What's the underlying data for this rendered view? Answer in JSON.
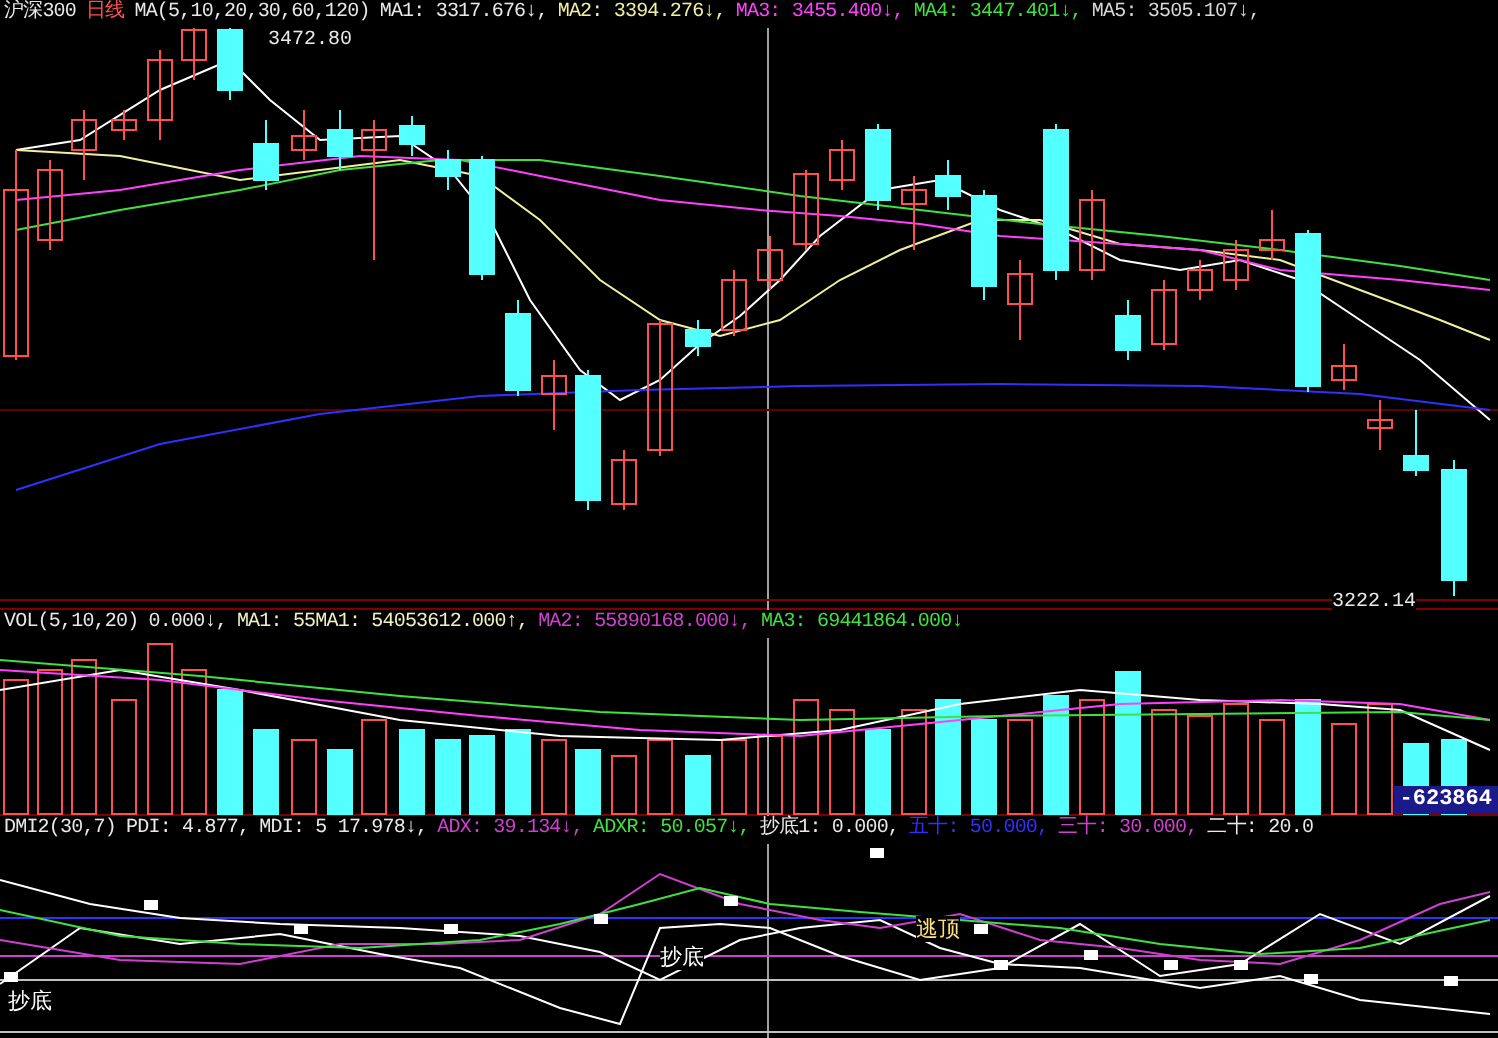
{
  "price_panel": {
    "header": [
      {
        "text": "沪深300",
        "color": "#e8e8e8"
      },
      {
        "text": "日线",
        "color": "#ff5050"
      },
      {
        "text": "MA(5,10,20,30,60,120)",
        "color": "#e8e8e8"
      },
      {
        "text": "MA1: 3317.676↓,",
        "color": "#e8e8e8"
      },
      {
        "text": "MA2: 3394.276↓,",
        "color": "#f0f0a0"
      },
      {
        "text": "MA3: 3455.400↓,",
        "color": "#ff40ff"
      },
      {
        "text": "MA4: 3447.401↓,",
        "color": "#40e040"
      },
      {
        "text": "MA5: 3505.107↓,",
        "color": "#d8d8d8"
      }
    ],
    "high_label": "3472.80",
    "low_label": "3222.14"
  },
  "volume_panel": {
    "header": [
      {
        "text": "VOL(5,10,20)",
        "color": "#e8e8e8"
      },
      {
        "text": "0.000↓,",
        "color": "#e8e8e8"
      },
      {
        "text": "MA1: 55MA1: 54053612.000↑,",
        "color": "#f0f0c0"
      },
      {
        "text": "MA2: 55890168.000↓,",
        "color": "#d040d0"
      },
      {
        "text": "MA3: 69441864.000↓",
        "color": "#40e040"
      }
    ],
    "reading": "-623864"
  },
  "dmi_panel": {
    "header": [
      {
        "text": "DMI2(30,7)",
        "color": "#e8e8e8"
      },
      {
        "text": "PDI: 4.877,",
        "color": "#e8e8e8"
      },
      {
        "text": "MDI: 5 17.978↓,",
        "color": "#e8e8e8"
      },
      {
        "text": "ADX: 39.134↓,",
        "color": "#d040d0"
      },
      {
        "text": "ADXR: 50.057↓,",
        "color": "#40e040"
      },
      {
        "text": "抄底1: 0.000,",
        "color": "#e8e8e8"
      },
      {
        "text": "五十: 50.000,",
        "color": "#3030ff"
      },
      {
        "text": "三十: 30.000,",
        "color": "#d040d0"
      },
      {
        "text": "二十: 20.0",
        "color": "#e8e8e8"
      }
    ],
    "labels": [
      {
        "text": "抄底",
        "color": "#ffffff"
      },
      {
        "text": "抄底",
        "color": "#ffffff"
      },
      {
        "text": "逃顶",
        "color": "#ffe080"
      }
    ]
  }
}
